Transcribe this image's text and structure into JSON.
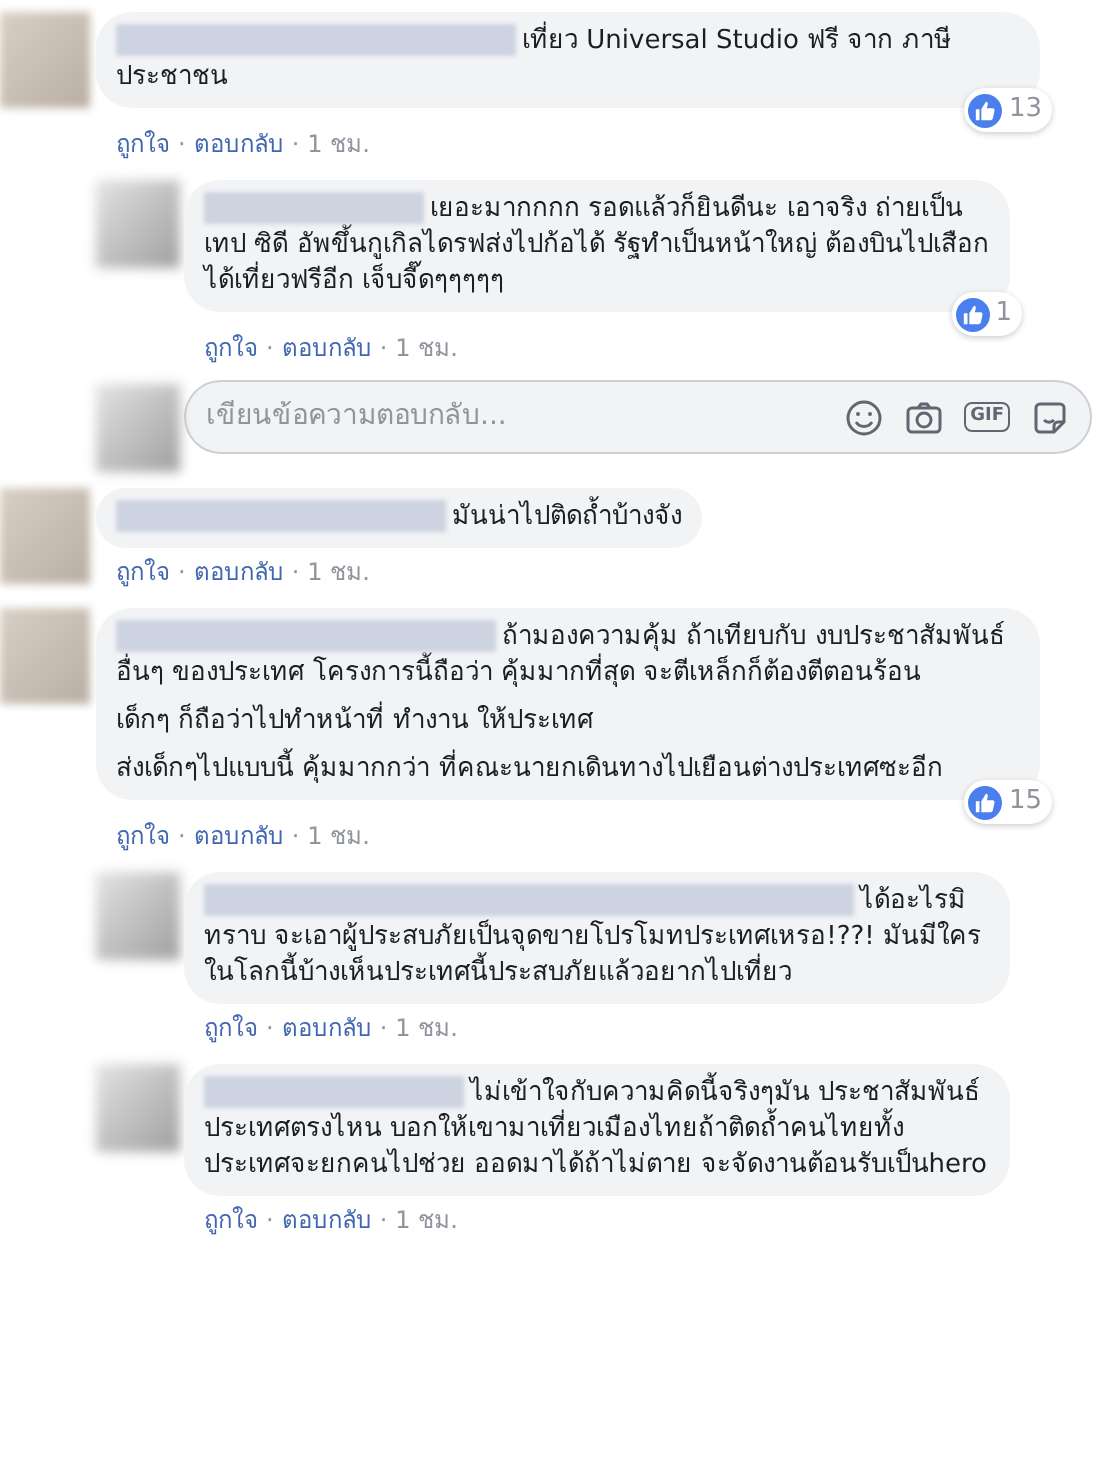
{
  "separator": "·",
  "comments": [
    {
      "kind": "comment",
      "paragraphs": [
        "เที่ยว Universal Studio ฟรี จาก ภาษีประชาชน"
      ],
      "likes": "13",
      "actions": {
        "like": "ถูกใจ",
        "reply": "ตอบกลับ",
        "time": "1 ชม."
      }
    },
    {
      "kind": "reply",
      "paragraphs": [
        "เยอะมากกกก รอดแล้วก็ยินดีนะ เอาจริง ถ่ายเป็นเทป ซิดี อัพขึ้นกูเกิลไดรฟส่งไปก้อได้ รัฐทำเป็นหน้าใหญ่ ต้องบินไปเสือกได้เที่ยวฟรีอีก เจ็บจี๊ดๆๆๆๆๆ"
      ],
      "likes": "1",
      "actions": {
        "like": "ถูกใจ",
        "reply": "ตอบกลับ",
        "time": "1 ชม."
      }
    },
    {
      "kind": "reply_box",
      "placeholder": "เขียนข้อความตอบกลับ...",
      "gif": "GIF"
    },
    {
      "kind": "comment",
      "paragraphs": [
        "มันน่าไปติดถ้ำบ้างจัง"
      ],
      "actions": {
        "like": "ถูกใจ",
        "reply": "ตอบกลับ",
        "time": "1 ชม."
      }
    },
    {
      "kind": "comment",
      "paragraphs": [
        "ถ้ามองความคุ้ม ถ้าเทียบกับ งบประชาสัมพันธ์อื่นๆ ของประเทศ โครงการนี้ถือว่า คุ้มมากที่สุด จะตีเหล็กก็ต้องตีตอนร้อน",
        "เด็กๆ ก็ถือว่าไปทำหน้าที่ ทำงาน ให้ประเทศ",
        "ส่งเด็กๆไปแบบนี้ คุ้มมากกว่า ที่คณะนายกเดินทางไปเยือนต่างประเทศซะอีก"
      ],
      "likes": "15",
      "actions": {
        "like": "ถูกใจ",
        "reply": "ตอบกลับ",
        "time": "1 ชม."
      }
    },
    {
      "kind": "reply",
      "paragraphs": [
        "ได้อะไรมิทราบ จะเอาผู้ประสบภัยเป็นจุดขายโปรโมทประเทศเหรอ!??! มันมีใครในโลกนี้บ้างเห็นประเทศนี้ประสบภัยแล้วอยากไปเที่ยว"
      ],
      "actions": {
        "like": "ถูกใจ",
        "reply": "ตอบกลับ",
        "time": "1 ชม."
      }
    },
    {
      "kind": "reply",
      "paragraphs": [
        "ไม่เข้าใจกับความคิดนี้จริงๆมัน ประชาสัมพันธ์ประเทศตรงไหน บอกให้เขามาเที่ยวเมืองไทยถ้าติดถ้ำคนไทยทั้งประเทศจะยกคนไปช่วย ออดมาได้ถ้าไม่ตาย จะจัดงานต้อนรับเป็นhero"
      ],
      "actions": {
        "like": "ถูกใจ",
        "reply": "ตอบกลับ",
        "time": "1 ชม."
      }
    }
  ]
}
